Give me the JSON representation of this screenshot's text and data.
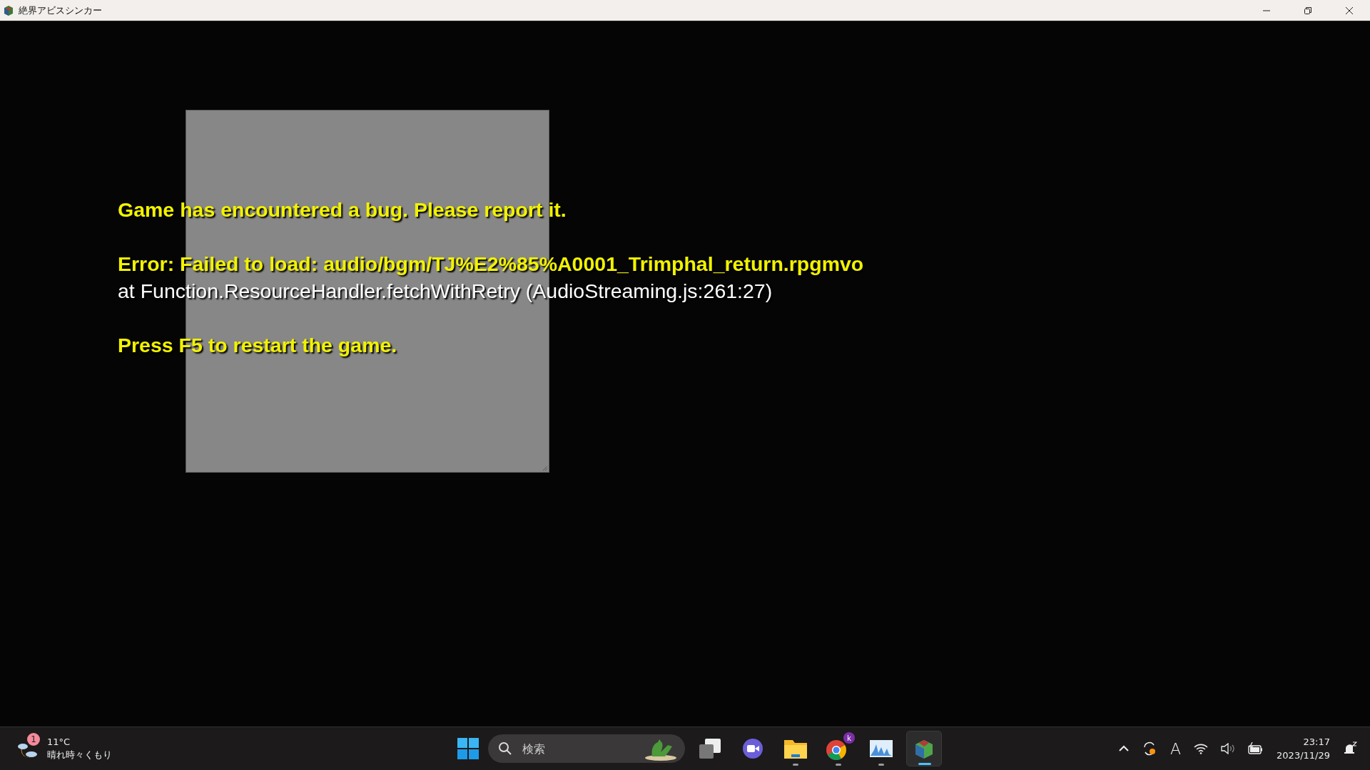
{
  "window": {
    "title": "絶界アビスシンカー"
  },
  "error_screen": {
    "lines": [
      {
        "kind": "heading",
        "text": "Game has encountered a bug. Please report it."
      },
      {
        "kind": "gap"
      },
      {
        "kind": "heading",
        "text": "Error: Failed to load: audio/bgm/TJ%E2%85%A0001_Trimphal_return.rpgmvo"
      },
      {
        "kind": "trace",
        "text": "at Function.ResourceHandler.fetchWithRetry (AudioStreaming.js:261:27)"
      },
      {
        "kind": "gap"
      },
      {
        "kind": "heading",
        "text": "Press F5 to restart the game."
      }
    ]
  },
  "taskbar": {
    "weather": {
      "badge": "1",
      "temperature": "11°C",
      "condition": "晴れ時々くもり"
    },
    "search": {
      "placeholder": "検索"
    },
    "apps": [
      {
        "kind": "taskview",
        "running": false,
        "selected": false
      },
      {
        "kind": "meet",
        "running": false,
        "selected": false
      },
      {
        "kind": "folder",
        "running": true,
        "selected": false
      },
      {
        "kind": "browser",
        "running": true,
        "selected": false,
        "badge": "k"
      },
      {
        "kind": "monitor",
        "running": true,
        "selected": false
      },
      {
        "kind": "game",
        "running": true,
        "selected": true
      }
    ],
    "clock": {
      "time": "23:17",
      "date": "2023/11/29"
    },
    "ime": "A"
  }
}
